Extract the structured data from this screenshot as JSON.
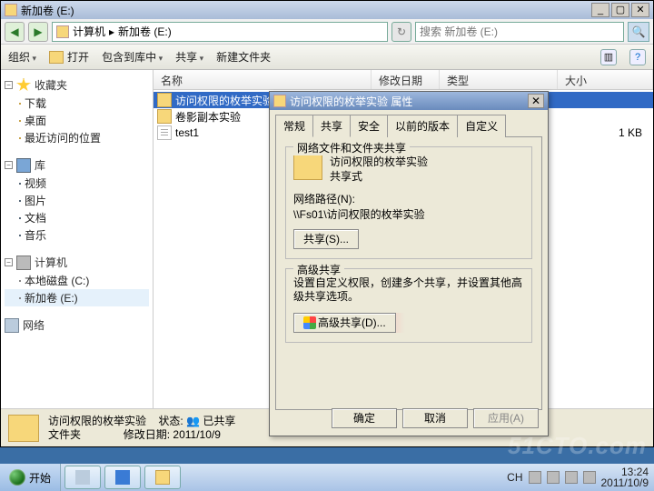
{
  "window": {
    "title": "新加卷 (E:)",
    "min": "_",
    "max": "▢",
    "close": "✕"
  },
  "nav": {
    "back": "◀",
    "fwd": "▶",
    "path_root": "计算机",
    "path_sep": "▸",
    "path_cur": "新加卷 (E:)",
    "refresh": "↻",
    "search_placeholder": "搜索 新加卷 (E:)",
    "search_icon": "🔍"
  },
  "toolbar": {
    "organize": "组织",
    "open": "打开",
    "include": "包含到库中",
    "share": "共享",
    "newfolder": "新建文件夹",
    "viewicon": "▥",
    "helpicon": "?"
  },
  "tree": {
    "favorites": "收藏夹",
    "fav_items": [
      "下载",
      "桌面",
      "最近访问的位置"
    ],
    "libraries": "库",
    "lib_items": [
      "视频",
      "图片",
      "文档",
      "音乐"
    ],
    "computer": "计算机",
    "drives": [
      "本地磁盘 (C:)",
      "新加卷 (E:)"
    ],
    "network": "网络"
  },
  "cols": {
    "name": "名称",
    "date": "修改日期",
    "type": "类型",
    "size": "大小"
  },
  "rows": [
    {
      "name": "访问权限的枚举实验",
      "type": "folder",
      "size": ""
    },
    {
      "name": "卷影副本实验",
      "type": "folder",
      "size": ""
    },
    {
      "name": "test1",
      "type": "file",
      "size": "1 KB"
    }
  ],
  "dialog": {
    "title": "访问权限的枚举实验 属性",
    "tabs": [
      "常规",
      "共享",
      "安全",
      "以前的版本",
      "自定义"
    ],
    "active_tab": 1,
    "group1_title": "网络文件和文件夹共享",
    "shared_name": "访问权限的枚举实验",
    "shared_state": "共享式",
    "path_label": "网络路径(N):",
    "path_value": "\\\\Fs01\\访问权限的枚举实验",
    "share_btn": "共享(S)...",
    "group2_title": "高级共享",
    "group2_desc": "设置自定义权限，创建多个共享，并设置其他高级共享选项。",
    "adv_btn": "高级共享(D)...",
    "ok": "确定",
    "cancel": "取消",
    "apply": "应用(A)"
  },
  "status": {
    "name": "访问权限的枚举实验",
    "type": "文件夹",
    "state_lbl": "状态:",
    "state_val": "已共享",
    "date_lbl": "修改日期:",
    "date_val": "2011/10/9"
  },
  "taskbar": {
    "start": "开始",
    "lang": "CH",
    "time": "13:24",
    "date": "2011/10/9"
  },
  "watermark": "51CTO.com"
}
